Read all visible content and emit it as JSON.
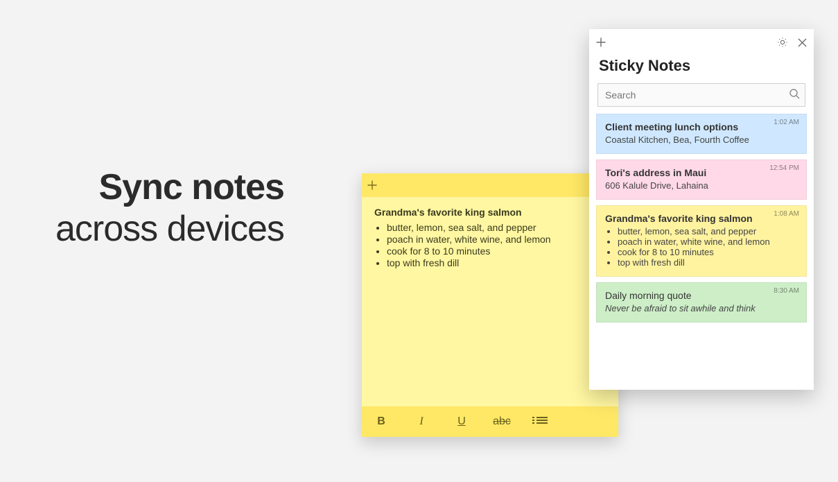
{
  "promo": {
    "line1": "Sync notes",
    "line2": "across devices"
  },
  "open_note": {
    "title": "Grandma's favorite king salmon",
    "items": [
      "butter, lemon, sea salt, and pepper",
      "poach in water, white wine, and lemon",
      "cook for 8 to 10 minutes",
      "top with fresh dill"
    ],
    "toolbar": {
      "bold": "B",
      "italic": "I",
      "underline": "U",
      "strike": "abc"
    }
  },
  "panel": {
    "title": "Sticky Notes",
    "search_placeholder": "Search",
    "notes": [
      {
        "color": "blue",
        "time": "1:02 AM",
        "title": "Client meeting lunch options",
        "body": "Coastal Kitchen, Bea, Fourth Coffee"
      },
      {
        "color": "pink",
        "time": "12:54 PM",
        "title": "Tori's address in Maui",
        "body": "606 Kalule Drive, Lahaina"
      },
      {
        "color": "yellow",
        "time": "1:08 AM",
        "title": "Grandma's favorite king salmon",
        "items": [
          "butter, lemon, sea salt, and pepper",
          "poach in water, white wine, and lemon",
          "cook for 8 to 10 minutes",
          "top with fresh dill"
        ]
      },
      {
        "color": "green",
        "time": "8:30 AM",
        "title": "Daily morning quote",
        "body_italic": "Never be afraid to sit awhile and think"
      }
    ]
  }
}
